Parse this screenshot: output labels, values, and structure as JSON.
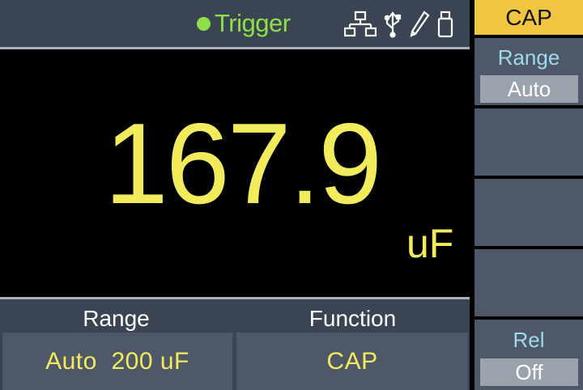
{
  "status_bar": {
    "trigger_label": "Trigger",
    "trigger_color": "#8ee04a",
    "icons": [
      "network-icon",
      "usb-icon",
      "pen-icon",
      "usb-drive-icon"
    ]
  },
  "display": {
    "reading": "167.9",
    "unit": "uF",
    "reading_color": "#f2ec5c"
  },
  "bottom_panel": {
    "range_header": "Range",
    "range_value": "Auto  200 uF",
    "function_header": "Function",
    "function_value": "CAP"
  },
  "softkeys": {
    "title": "CAP",
    "title_color": "#f0c542",
    "range_label": "Range",
    "range_value": "Auto",
    "rel_label": "Rel",
    "rel_value": "Off"
  }
}
